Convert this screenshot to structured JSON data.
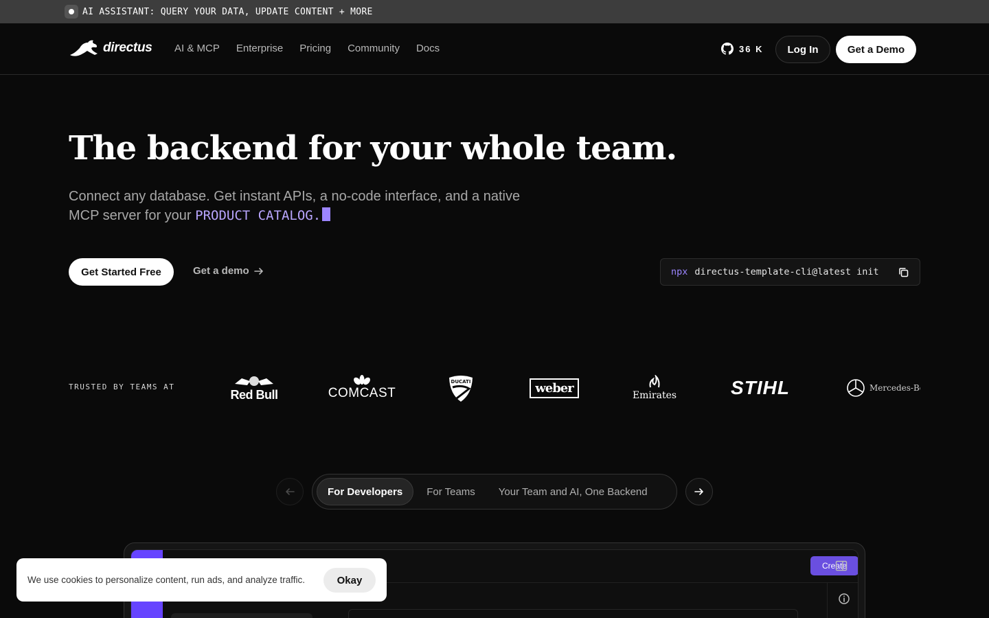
{
  "announcement": {
    "text": "AI ASSISTANT: QUERY YOUR DATA, UPDATE CONTENT + MORE"
  },
  "nav": {
    "brand": "directus",
    "links": [
      "AI & MCP",
      "Enterprise",
      "Pricing",
      "Community",
      "Docs"
    ],
    "github_stars": "36 K",
    "login_label": "Log In",
    "demo_label": "Get a Demo"
  },
  "hero": {
    "title": "The backend for your whole team.",
    "subtitle": "Connect any database. Get instant APIs, a no-code interface, and a native MCP server for your",
    "highlight": "PRODUCT CATALOG.",
    "cta_primary": "Get Started Free",
    "cta_secondary": "Get a demo",
    "command_prefix": "npx",
    "command": "directus-template-cli@latest init"
  },
  "trusted": {
    "label": "TRUSTED BY TEAMS AT",
    "brands": [
      "Red Bull",
      "COMCAST",
      "DUCATI",
      "weber",
      "Emirates",
      "STIHL",
      "Mercedes-Benz"
    ]
  },
  "tabs": {
    "items": [
      "For Developers",
      "For Teams",
      "Your Team and AI, One Backend"
    ],
    "active": "For Developers"
  },
  "app_preview": {
    "create_label": "Create"
  },
  "cookie": {
    "message": "We use cookies to personalize content, run ads, and analyze traffic.",
    "ok_label": "Okay"
  },
  "colors": {
    "accent": "#6644ff",
    "highlight": "#b9a6ff",
    "background": "#0a0a0a"
  }
}
